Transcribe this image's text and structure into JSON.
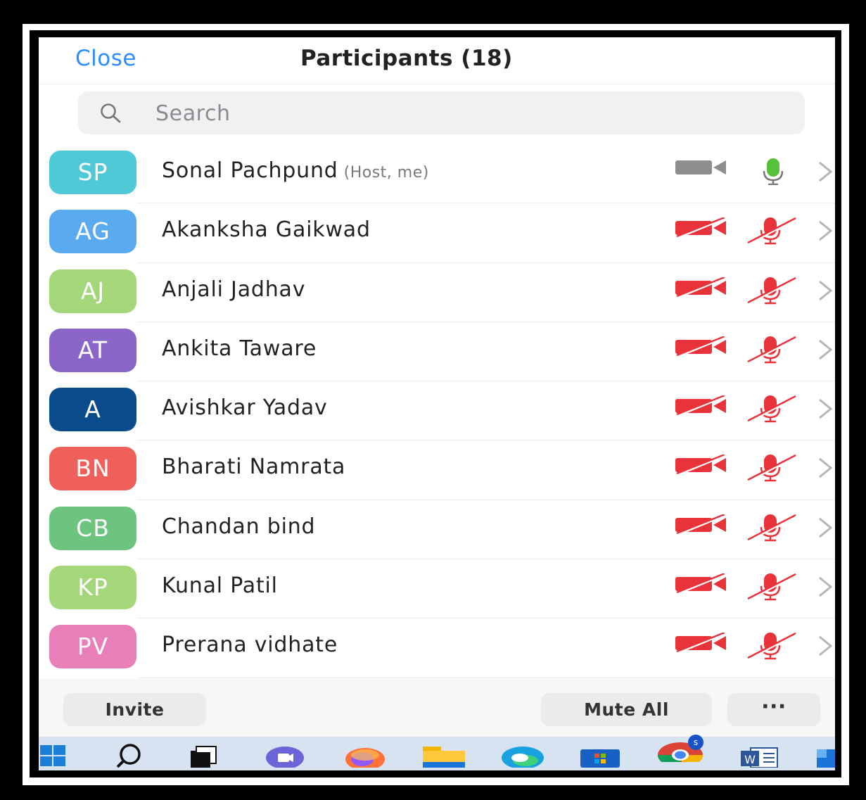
{
  "header": {
    "close_label": "Close",
    "title": "Participants (18)"
  },
  "search": {
    "placeholder": "Search",
    "value": ""
  },
  "participants": [
    {
      "initials": "SP",
      "name": "Sonal Pachpund",
      "tag": "(Host, me)",
      "avatar_color": "#4fc9d6",
      "video": "on",
      "audio": "on"
    },
    {
      "initials": "AG",
      "name": "Akanksha Gaikwad",
      "tag": "",
      "avatar_color": "#5aaaf0",
      "video": "off",
      "audio": "muted"
    },
    {
      "initials": "AJ",
      "name": "Anjali Jadhav",
      "tag": "",
      "avatar_color": "#a3d77a",
      "video": "off",
      "audio": "muted"
    },
    {
      "initials": "AT",
      "name": "Ankita Taware",
      "tag": "",
      "avatar_color": "#8a66c9",
      "video": "off",
      "audio": "muted"
    },
    {
      "initials": "A",
      "name": "Avishkar Yadav",
      "tag": "",
      "avatar_color": "#0a4b8c",
      "video": "off",
      "audio": "muted"
    },
    {
      "initials": "BN",
      "name": "Bharati Namrata",
      "tag": "",
      "avatar_color": "#f0605a",
      "video": "off",
      "audio": "muted"
    },
    {
      "initials": "CB",
      "name": "Chandan bind",
      "tag": "",
      "avatar_color": "#6cc47e",
      "video": "off",
      "audio": "muted"
    },
    {
      "initials": "KP",
      "name": "Kunal Patil",
      "tag": "",
      "avatar_color": "#a3d77a",
      "video": "off",
      "audio": "muted"
    },
    {
      "initials": "PV",
      "name": "Prerana vidhate",
      "tag": "",
      "avatar_color": "#e87fb8",
      "video": "off",
      "audio": "muted"
    }
  ],
  "footer": {
    "invite_label": "Invite",
    "mute_all_label": "Mute All",
    "more_label": "···"
  },
  "taskbar": {
    "icons": [
      "windows-start-icon",
      "search-icon",
      "task-view-icon",
      "teams-chat-icon",
      "firefox-icon",
      "file-explorer-icon",
      "edge-icon",
      "microsoft-store-icon",
      "chrome-icon",
      "word-icon",
      "app-icon"
    ],
    "chrome_badge": "s"
  },
  "colors": {
    "accent": "#2d8cff",
    "muted_red": "#e8333a",
    "mic_on_green": "#56c23a",
    "video_on_grey": "#8e8e8e"
  }
}
